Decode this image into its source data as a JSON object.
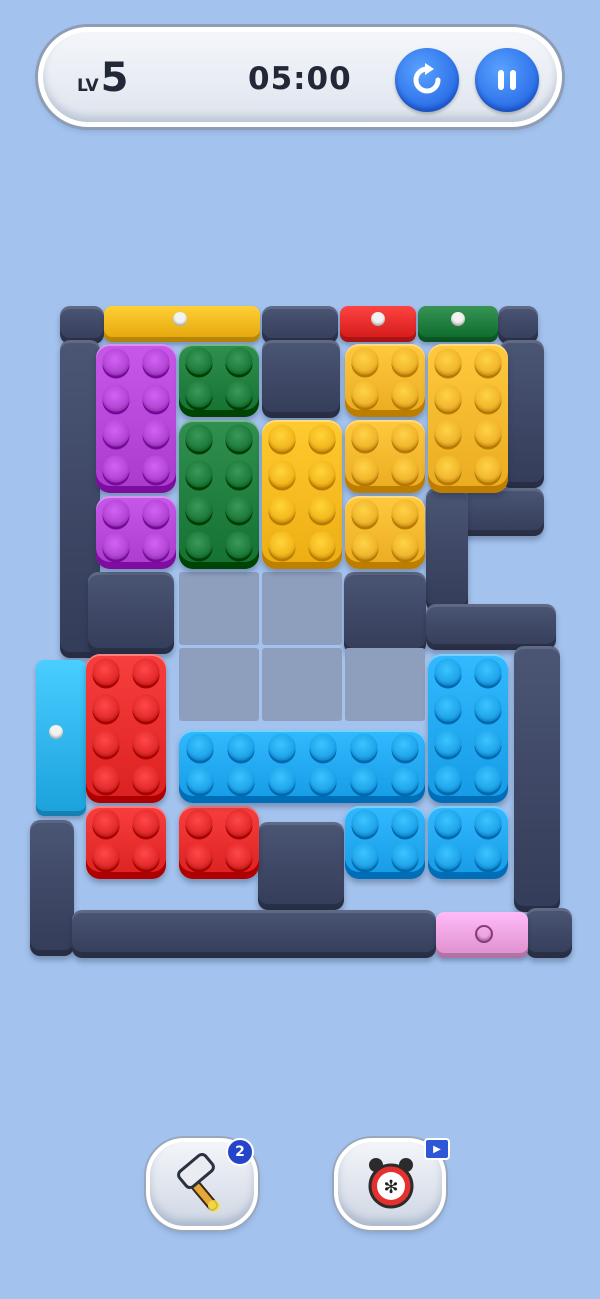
{
  "header": {
    "level_label": "LV",
    "level_number": "5",
    "timer": "05:00",
    "restart_icon": "restart-icon",
    "pause_icon": "pause-icon"
  },
  "colors": {
    "background": "#a3c3ee",
    "wall": "#3a4463",
    "empty_cell": "#8e9fbe",
    "purple": "#b344d6",
    "green": "#1d7b3c",
    "yellow": "#f6b71c",
    "orange": "#f4b52a",
    "red": "#e52a2a",
    "blue": "#1ea5ee",
    "pink": "#f0a2df",
    "light_blue_gate": "#2fb5ef",
    "accent_blue": "#2a6fe8"
  },
  "board": {
    "grid_columns": 6,
    "grid_rows": 7,
    "blocks": [
      {
        "color": "purple",
        "col": 0,
        "row": 0,
        "w": 1,
        "h": 2
      },
      {
        "color": "purple",
        "col": 0,
        "row": 2,
        "w": 1,
        "h": 1
      },
      {
        "color": "green",
        "col": 1,
        "row": 0,
        "w": 1,
        "h": 1
      },
      {
        "color": "green",
        "col": 1,
        "row": 1,
        "w": 1,
        "h": 2
      },
      {
        "color": "yellow",
        "col": 2,
        "row": 1,
        "w": 1,
        "h": 2
      },
      {
        "color": "orange",
        "col": 3,
        "row": 0,
        "w": 1,
        "h": 1
      },
      {
        "color": "orange",
        "col": 3,
        "row": 1,
        "w": 1,
        "h": 1
      },
      {
        "color": "orange",
        "col": 3,
        "row": 2,
        "w": 1,
        "h": 1
      },
      {
        "color": "orange",
        "col": 4,
        "row": 0,
        "w": 1,
        "h": 2
      },
      {
        "color": "red",
        "col": 0,
        "row": 4,
        "w": 1,
        "h": 2
      },
      {
        "color": "red",
        "col": 0,
        "row": 6,
        "w": 1,
        "h": 1
      },
      {
        "color": "red",
        "col": 1,
        "row": 6,
        "w": 1,
        "h": 1
      },
      {
        "color": "blue",
        "col": 1,
        "row": 5,
        "w": 3,
        "h": 1
      },
      {
        "color": "blue",
        "col": 4,
        "row": 4,
        "w": 1,
        "h": 2
      },
      {
        "color": "blue",
        "col": 3,
        "row": 6,
        "w": 1,
        "h": 1
      },
      {
        "color": "blue",
        "col": 4,
        "row": 6,
        "w": 1,
        "h": 1
      }
    ],
    "gates": [
      {
        "color": "yellow",
        "name": "yellow-gate"
      },
      {
        "color": "red",
        "name": "red-gate"
      },
      {
        "color": "green",
        "name": "green-gate"
      },
      {
        "color": "light_blue_gate",
        "name": "blue-gate"
      },
      {
        "color": "pink",
        "name": "pink-gate"
      }
    ]
  },
  "powerups": [
    {
      "name": "hammer",
      "icon": "hammer-icon",
      "count": "2"
    },
    {
      "name": "freeze-clock",
      "icon": "freeze-clock-icon",
      "tag_icon": "video-ad-icon"
    }
  ]
}
